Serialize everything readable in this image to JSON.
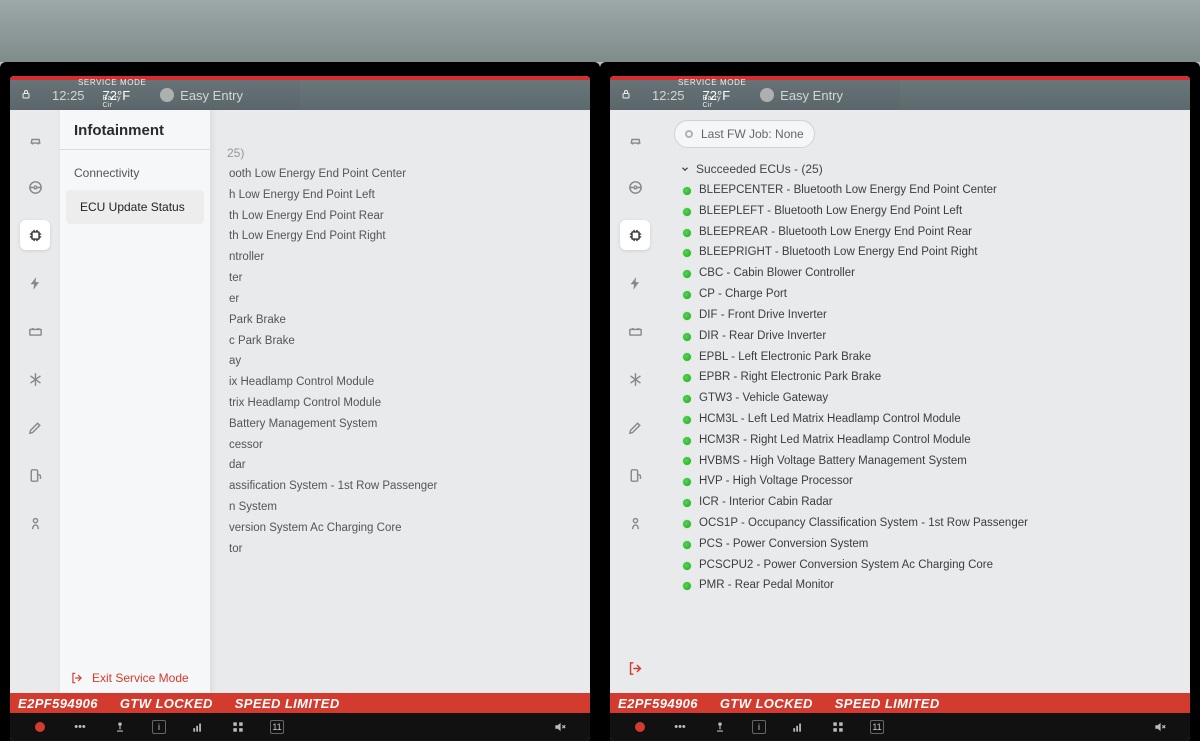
{
  "statusbar": {
    "service_mode_label": "SERVICE MODE",
    "time": "12:25",
    "temp": "72°F",
    "temp_sub": "Barry Cir",
    "profile": "Easy Entry"
  },
  "banner": {
    "vin_fragment": "E2PF594906",
    "gateway": "GTW LOCKED",
    "speed": "SPEED LIMITED"
  },
  "rail_icons": [
    "car",
    "steering",
    "chip",
    "bolt",
    "battery",
    "snow",
    "pencil",
    "fuel",
    "airbag",
    "exit"
  ],
  "submenu": {
    "title": "Infotainment",
    "items": [
      "Connectivity",
      "ECU Update Status"
    ],
    "selected_index": 1,
    "exit_label": "Exit Service Mode"
  },
  "panelA_peek": {
    "count_fragment": "25)",
    "rows": [
      "ooth Low Energy End Point Center",
      "h Low Energy End Point Left",
      "th Low Energy End Point Rear",
      "th Low Energy End Point Right",
      "ntroller",
      "ter",
      "er",
      "Park Brake",
      "c Park Brake",
      "ay",
      "ix Headlamp Control Module",
      "trix Headlamp Control Module",
      "Battery Management System",
      "cessor",
      "dar",
      "assification System - 1st Row Passenger",
      "n System",
      "version System Ac Charging Core",
      "tor"
    ]
  },
  "panelB": {
    "fw_job": "Last FW Job: None",
    "group_header": "Succeeded ECUs - (25)",
    "ecus": [
      "BLEEPCENTER - Bluetooth Low Energy End Point Center",
      "BLEEPLEFT - Bluetooth Low Energy End Point Left",
      "BLEEPREAR - Bluetooth Low Energy End Point Rear",
      "BLEEPRIGHT - Bluetooth Low Energy End Point Right",
      "CBC - Cabin Blower Controller",
      "CP - Charge Port",
      "DIF - Front Drive Inverter",
      "DIR - Rear Drive Inverter",
      "EPBL - Left Electronic Park Brake",
      "EPBR - Right Electronic Park Brake",
      "GTW3 - Vehicle Gateway",
      "HCM3L - Left Led Matrix Headlamp Control Module",
      "HCM3R - Right Led Matrix Headlamp Control Module",
      "HVBMS - High Voltage Battery Management System",
      "HVP - High Voltage Processor",
      "ICR - Interior Cabin Radar",
      "OCS1P - Occupancy Classification System - 1st Row Passenger",
      "PCS - Power Conversion System",
      "PCSCPU2 - Power Conversion System Ac Charging Core",
      "PMR - Rear Pedal Monitor"
    ]
  },
  "dock": {
    "cal_day": "11"
  }
}
